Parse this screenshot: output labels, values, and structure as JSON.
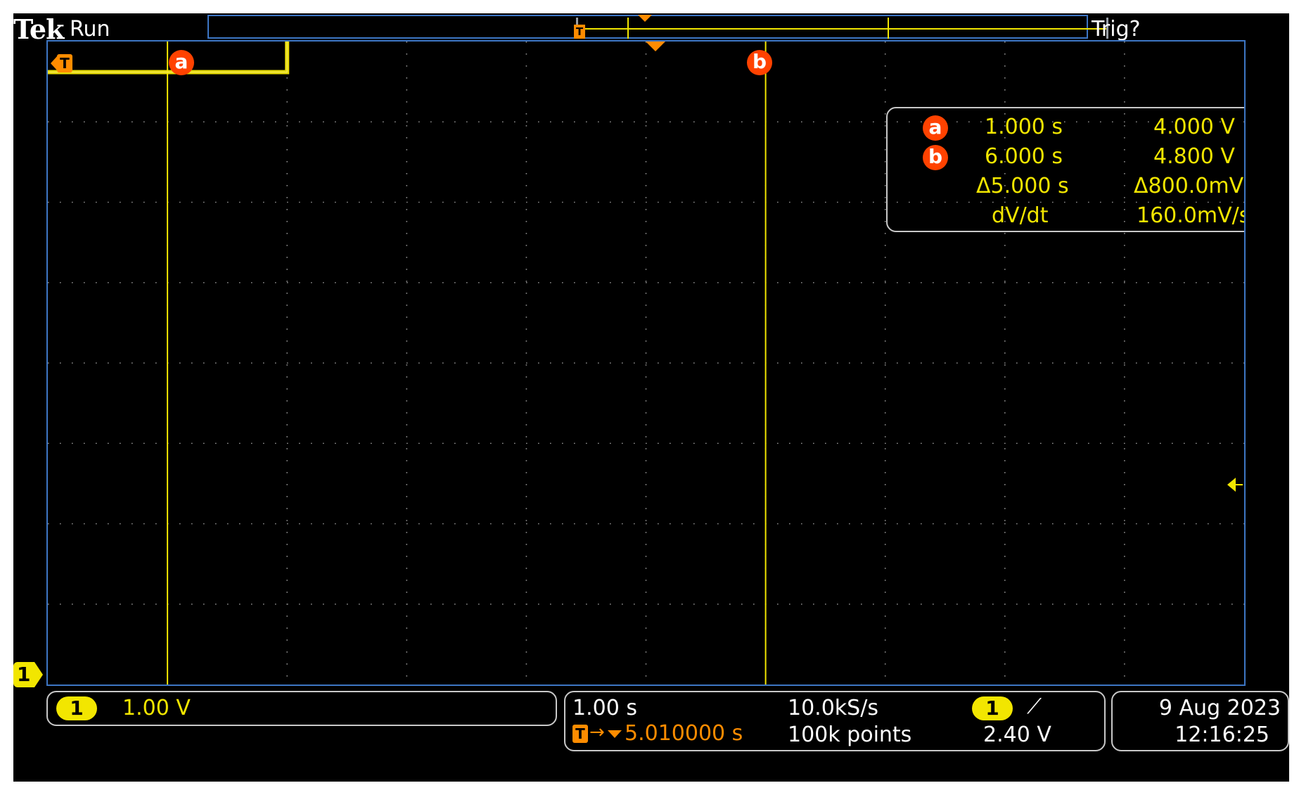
{
  "header": {
    "brand": "Tek",
    "run_state": "Run",
    "trigger_state": "Trig?"
  },
  "markers": {
    "trigger_top": "T",
    "trigger_left": "T",
    "cursor_a": "a",
    "cursor_b": "b",
    "channel_ground": "1"
  },
  "cursor_readout": {
    "a_label": "a",
    "a_time": "1.000 s",
    "a_volt": "4.000 V",
    "b_label": "b",
    "b_time": "6.000 s",
    "b_volt": "4.800 V",
    "delta_time": "Δ5.000 s",
    "delta_volt": "Δ800.0mV",
    "rate_label": "dV/dt",
    "rate_value": "160.0mV/s"
  },
  "channel_panel": {
    "channel": "1",
    "scale": "1.00 V"
  },
  "timebase_panel": {
    "time_per_div": "1.00 s",
    "trigger_position": "5.010000 s",
    "sample_rate": "10.0kS/s",
    "record_length": "100k points",
    "trigger_source": "1",
    "trigger_slope": "⟋",
    "trigger_level": "2.40 V"
  },
  "datetime_panel": {
    "date": "9 Aug 2023",
    "time": "12:16:25"
  },
  "colors": {
    "trace": "#f2e600",
    "grid_border": "#3d76c4",
    "cursor_badge": "#ff4200",
    "trigger_marker": "#ff8c00"
  },
  "chart_data": {
    "type": "line",
    "title": "",
    "xlabel": "",
    "ylabel": "",
    "x_unit": "s",
    "y_unit": "V",
    "xlim": [
      0,
      10
    ],
    "ylim": [
      -4,
      4.4
    ],
    "series": [
      {
        "x": [
          0,
          2,
          2.0,
          10
        ],
        "y": [
          4.0,
          4.0,
          4.8,
          4.8
        ]
      }
    ],
    "cursors": {
      "a_x": 1.0,
      "b_x": 6.0
    },
    "trigger_level_v": 2.4,
    "grid": true
  }
}
